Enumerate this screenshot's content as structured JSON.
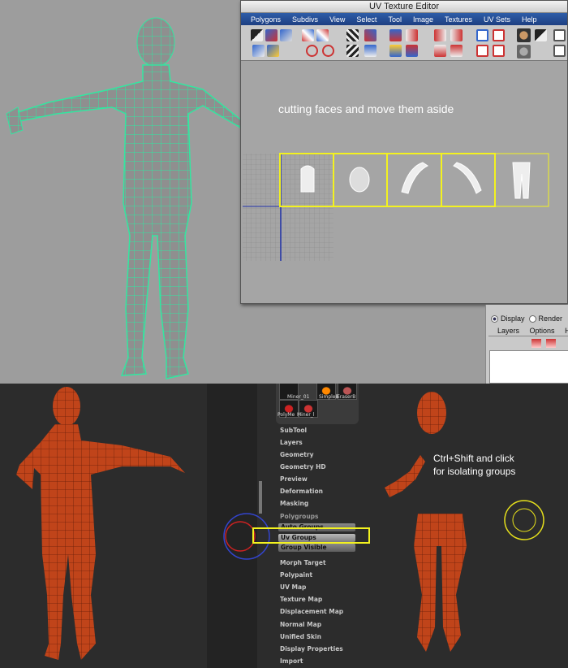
{
  "uv_editor": {
    "title": "UV Texture Editor",
    "menu": [
      "Polygons",
      "Subdivs",
      "View",
      "Select",
      "Tool",
      "Image",
      "Textures",
      "UV Sets",
      "Help"
    ],
    "caption": "cutting faces and move them aside"
  },
  "channel_box": {
    "display_label": "Display",
    "render_label": "Render",
    "tabs": [
      "Layers",
      "Options",
      "He"
    ]
  },
  "zbrush": {
    "subtool_thumbs": [
      "Miner_01",
      "SimpleB",
      "EraserB",
      "PolyMe",
      "Miner_l"
    ],
    "menu_items_top": [
      "SubTool",
      "Layers",
      "Geometry",
      "Geometry HD",
      "Preview",
      "Deformation",
      "Masking"
    ],
    "polygroups": {
      "header": "Polygroups",
      "buttons": [
        "Auto Groups",
        "Uv Groups",
        "Group Visible"
      ]
    },
    "menu_items_bottom": [
      "Morph Target",
      "Polypaint",
      "UV Map",
      "Texture Map",
      "Displacement Map",
      "Normal Map",
      "Unified Skin",
      "Display Properties",
      "Import"
    ],
    "note_line1": "Ctrl+Shift and click",
    "note_line2": "for isolating groups"
  },
  "colors": {
    "wire_green": "#33e6a0",
    "highlight_yellow": "#f3f21f",
    "mesh_orange": "#c0441a"
  }
}
